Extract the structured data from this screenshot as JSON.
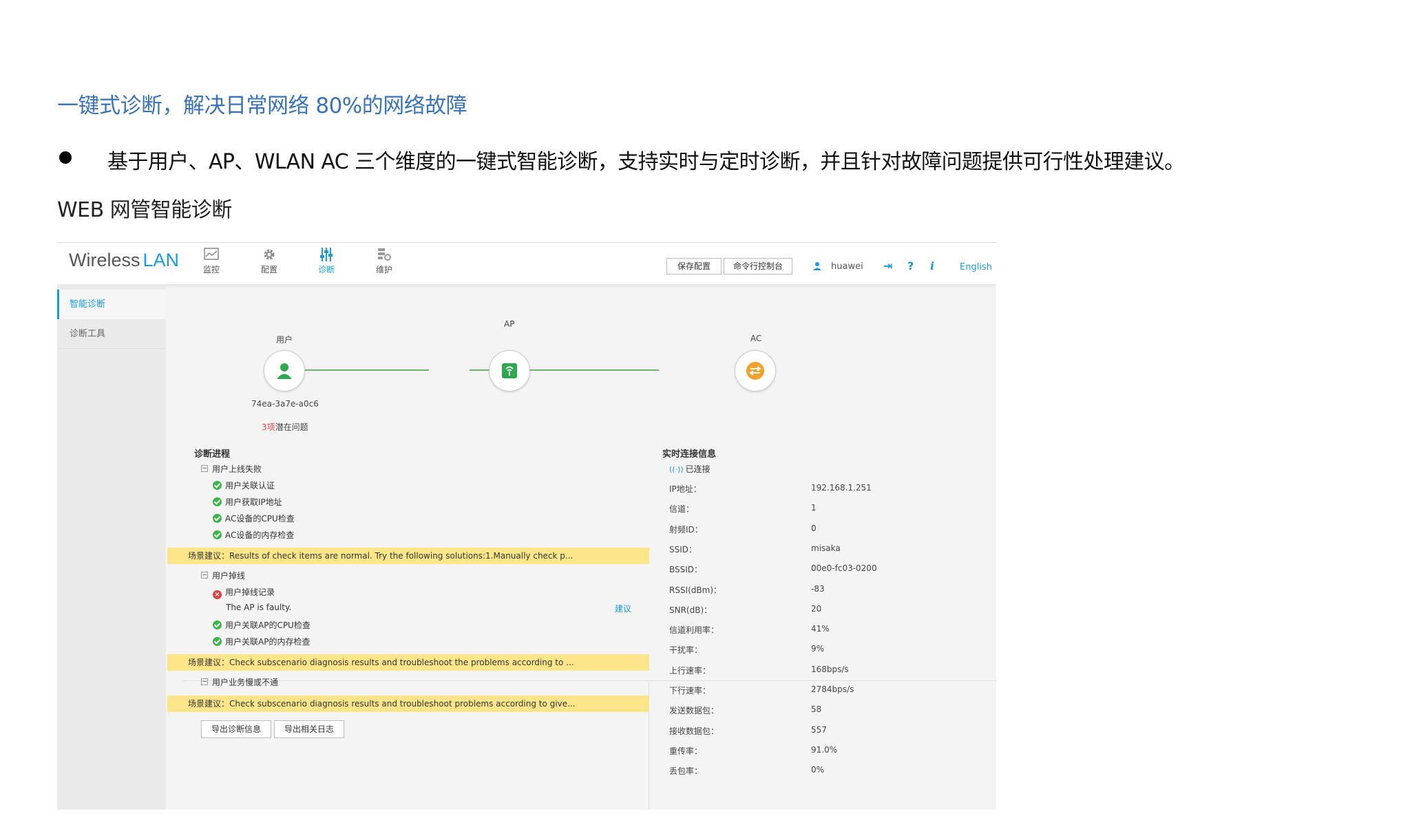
{
  "doc": {
    "heading": "一键式诊断，解决日常网络 80%的网络故障",
    "bullet": "基于用户、AP、WLAN AC 三个维度的一键式智能诊断，支持实时与定时诊断，并且针对故障问题提供可行性处理建议。",
    "subheading": "WEB 网管智能诊断"
  },
  "app": {
    "brand_left": "Wireless",
    "brand_right": "LAN",
    "nav": [
      {
        "label": "监控",
        "icon": "monitor-icon"
      },
      {
        "label": "配置",
        "icon": "gear-icon"
      },
      {
        "label": "诊断",
        "icon": "sliders-icon"
      },
      {
        "label": "维护",
        "icon": "maintenance-icon"
      }
    ],
    "toolbar": {
      "save_label": "保存配置",
      "cli_label": "命令行控制台",
      "username": "huawei",
      "language": "English"
    },
    "sidebar": [
      {
        "label": "智能诊断"
      },
      {
        "label": "诊断工具"
      }
    ],
    "topology": {
      "user_label": "用户",
      "ap_label": "AP",
      "ac_label": "AC",
      "mac": "74ea-3a7e-a0c6",
      "issue_count": "3项",
      "issue_text": "潜在问题"
    },
    "progress": {
      "title": "诊断进程",
      "group1": "用户上线失败",
      "g1_items": [
        "用户关联认证",
        "用户获取IP地址",
        "AC设备的CPU检查",
        "AC设备的内存检查"
      ],
      "warn1": "场景建议：Results of check items are normal. Try the following solutions:1.Manually check p...",
      "group2": "用户掉线",
      "g2_err": "用户掉线记录",
      "g2_err_detail": "The AP is faulty.",
      "g2_suggest": "建议",
      "g2_items": [
        "用户关联AP的CPU检查",
        "用户关联AP的内存检查"
      ],
      "warn2": "场景建议：Check subscenario diagnosis results and troubleshoot the problems according to ...",
      "group3": "用户业务慢或不通",
      "warn3": "场景建议：Check subscenario diagnosis results and troubleshoot problems according to give...",
      "export_diag": "导出诊断信息",
      "export_log": "导出相关日志"
    },
    "realtime": {
      "title": "实时连接信息",
      "status": "已连接",
      "rows": [
        {
          "label": "IP地址：",
          "value": "192.168.1.251"
        },
        {
          "label": "信道：",
          "value": "1"
        },
        {
          "label": "射频ID：",
          "value": "0"
        },
        {
          "label": "SSID：",
          "value": "misaka"
        },
        {
          "label": "BSSID：",
          "value": "00e0-fc03-0200"
        },
        {
          "label": "RSSI(dBm)：",
          "value": "-83"
        },
        {
          "label": "SNR(dB)：",
          "value": "20"
        },
        {
          "label": "信道利用率：",
          "value": "41%"
        },
        {
          "label": "干扰率：",
          "value": "9%"
        },
        {
          "label": "上行速率：",
          "value": "168bps/s"
        },
        {
          "label": "下行速率：",
          "value": "2784bps/s"
        },
        {
          "label": "发送数据包：",
          "value": "58"
        },
        {
          "label": "接收数据包：",
          "value": "557"
        },
        {
          "label": "重传率：",
          "value": "91.0%"
        },
        {
          "label": "丢包率：",
          "value": "0%"
        }
      ]
    },
    "colors": {
      "accent": "#1a9ad8",
      "ok": "#3cb44b",
      "error": "#e04040",
      "warn": "#fde58a",
      "link": "#6ab56a",
      "ac_node": "#f2a22a"
    }
  }
}
